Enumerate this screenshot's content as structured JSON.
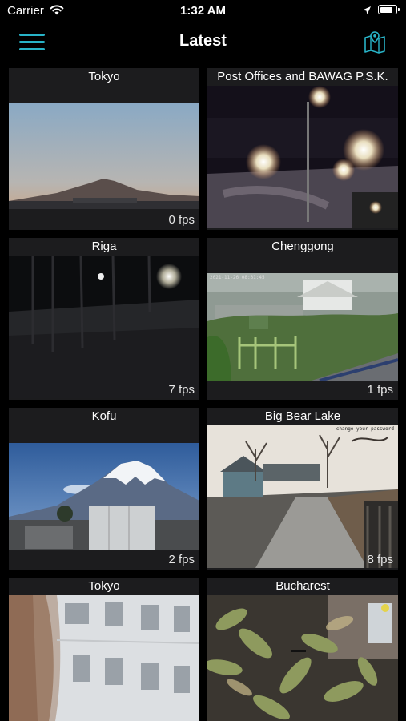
{
  "status_bar": {
    "carrier": "Carrier",
    "time": "1:32 AM",
    "battery_level": 0.85
  },
  "nav": {
    "title": "Latest",
    "menu_icon": "hamburger-menu-icon",
    "map_icon": "map-pin-icon"
  },
  "accent_color": "#28b3c7",
  "cameras": [
    {
      "title": "Tokyo",
      "fps": "0 fps"
    },
    {
      "title": "Post Offices and BAWAG P.S.K.",
      "fps": ""
    },
    {
      "title": "Riga",
      "fps": "7 fps"
    },
    {
      "title": "Chenggong",
      "fps": "1 fps",
      "overlay": "2021-11-26  08:31:45"
    },
    {
      "title": "Kofu",
      "fps": "2 fps"
    },
    {
      "title": "Big Bear Lake",
      "fps": "8 fps",
      "overlay": "change your password"
    },
    {
      "title": "Tokyo",
      "fps": ""
    },
    {
      "title": "Bucharest",
      "fps": ""
    }
  ]
}
